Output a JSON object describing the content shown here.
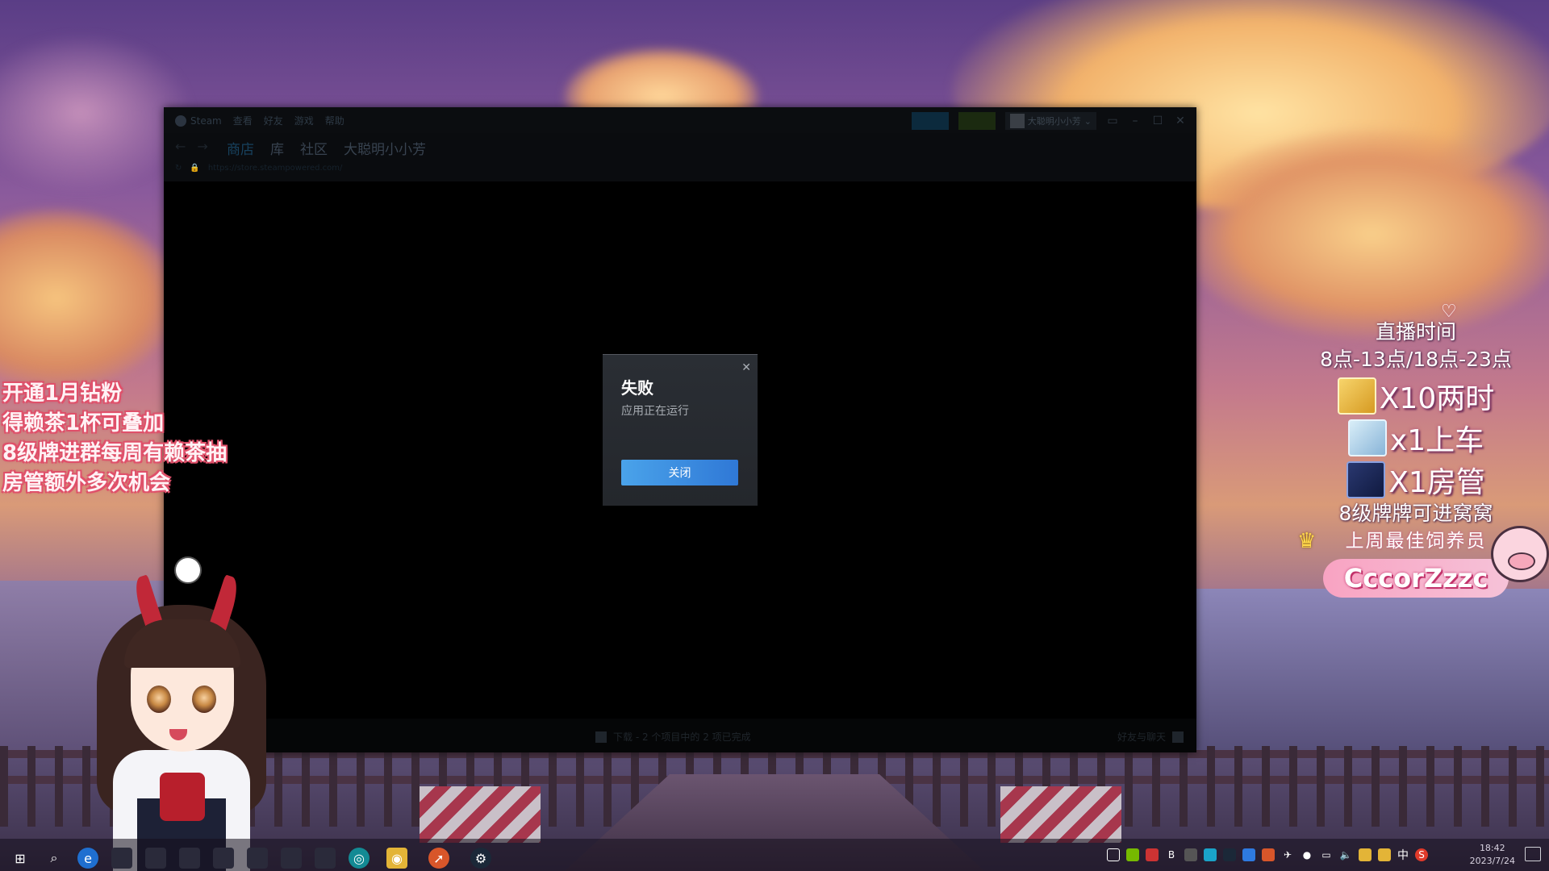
{
  "steam": {
    "menu": [
      "Steam",
      "查看",
      "好友",
      "游戏",
      "帮助"
    ],
    "account_name": "大聪明小小芳",
    "nav_tabs": [
      "商店",
      "库",
      "社区",
      "大聪明小小芳"
    ],
    "active_tab": "商店",
    "url": "https://store.steampowered.com/",
    "footer_download": "下载 - 2 个项目中的 2 项已完成",
    "footer_friends": "好友与聊天"
  },
  "dialog": {
    "title": "失败",
    "message": "应用正在运行",
    "button_label": "关闭"
  },
  "overlay_left": {
    "lines": [
      "开通1月钻粉",
      "得赖茶1杯可叠加",
      "8级牌进群每周有赖茶抽",
      "房管额外多次机会"
    ]
  },
  "overlay_right": {
    "title": "直播时间",
    "hours": "8点-13点/18点-23点",
    "rewards": [
      "X10两时",
      "x1上车",
      "X1房管"
    ],
    "level_note": "8级牌牌可进窝窝",
    "best_feeder_label": "上周最佳饲养员",
    "best_feeder_name": "CccorZzzc"
  },
  "taskbar": {
    "ime": "中",
    "time": "18:42",
    "date": "2023/7/24"
  },
  "colors": {
    "dialog_button": "#3a8de0",
    "dialog_bg": "#26292e",
    "overlay_pink": "#e0506a"
  }
}
